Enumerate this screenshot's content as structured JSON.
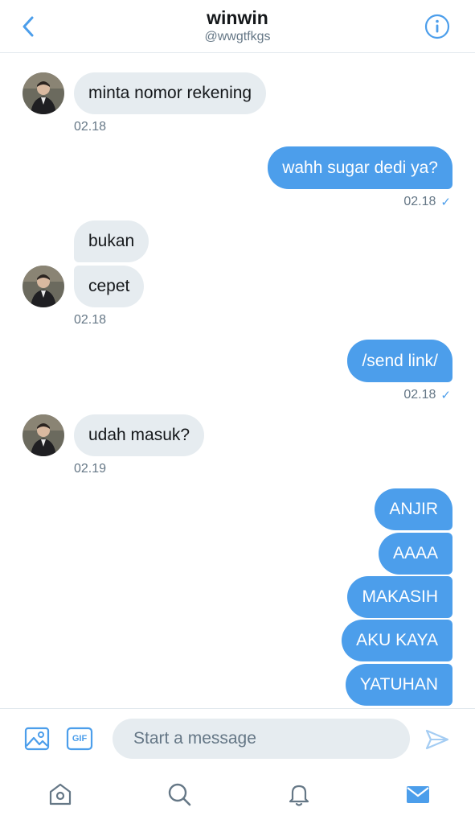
{
  "header": {
    "title": "winwin",
    "handle": "@wwgtfkgs"
  },
  "messages": [
    {
      "side": "recv",
      "text": "minta nomor rekening"
    },
    {
      "side": "recv",
      "time": "02.18"
    },
    {
      "side": "sent",
      "text": "wahh sugar dedi ya?"
    },
    {
      "side": "sent",
      "time": "02.18"
    },
    {
      "side": "recv",
      "text": "bukan"
    },
    {
      "side": "recv",
      "text": "cepet"
    },
    {
      "side": "recv",
      "time": "02.18"
    },
    {
      "side": "sent",
      "text": "/send link/"
    },
    {
      "side": "sent",
      "time": "02.18"
    },
    {
      "side": "recv",
      "text": "udah masuk?"
    },
    {
      "side": "recv",
      "time": "02.19"
    },
    {
      "side": "sent",
      "text": "ANJIR"
    },
    {
      "side": "sent",
      "text": "AAAA"
    },
    {
      "side": "sent",
      "text": "MAKASIH"
    },
    {
      "side": "sent",
      "text": "AKU KAYA"
    },
    {
      "side": "sent",
      "text": "YATUHAN"
    }
  ],
  "thread": {
    "m1": "minta nomor rekening",
    "t1": "02.18",
    "m2": "wahh sugar dedi ya?",
    "t2": "02.18",
    "m3": "bukan",
    "m4": "cepet",
    "t3": "02.18",
    "m5": "/send link/",
    "t4": "02.18",
    "m6": "udah masuk?",
    "t5": "02.19",
    "m7": "ANJIR",
    "m8": "AAAA",
    "m9": "MAKASIH",
    "m10": "AKU KAYA",
    "m11": "YATUHAN"
  },
  "composer": {
    "placeholder": "Start a message",
    "gif_label": "GIF"
  },
  "icons": {
    "back": "chevron-left-icon",
    "info": "info-icon",
    "image": "image-icon",
    "gif": "gif-icon",
    "send": "send-icon",
    "home": "home-icon",
    "search": "search-icon",
    "notifications": "bell-icon",
    "messages": "mail-icon"
  },
  "colors": {
    "accent": "#4c9eeb",
    "received_bubble": "#e6ecf0",
    "muted_text": "#657786"
  }
}
